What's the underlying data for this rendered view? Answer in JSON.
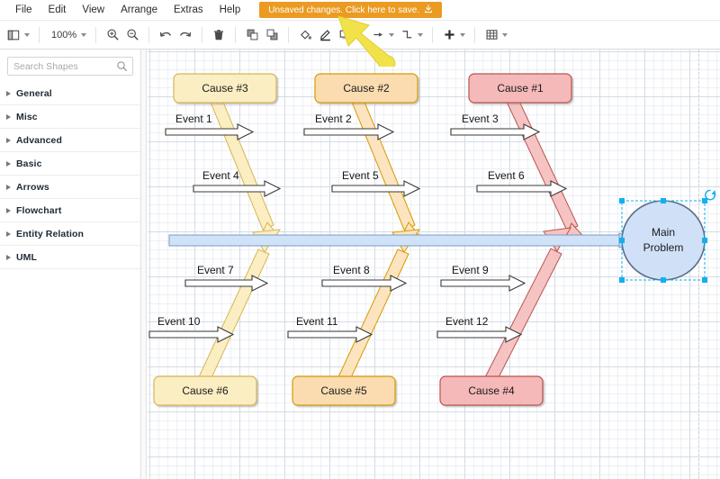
{
  "app": {
    "title": "draw.io diagram editor",
    "zoom": "100%"
  },
  "menu": {
    "items": [
      {
        "label": "File"
      },
      {
        "label": "Edit"
      },
      {
        "label": "View"
      },
      {
        "label": "Arrange"
      },
      {
        "label": "Extras"
      },
      {
        "label": "Help"
      }
    ],
    "unsaved": {
      "label": "Unsaved changes. Click here to save.",
      "icon": "save-icon",
      "background": "#eb9b21",
      "text_color": "#ffffff"
    }
  },
  "toolbar": {
    "view_icon": "layers-view-icon",
    "zoom_label": "100%",
    "zoom_in_icon": "zoom-in-icon",
    "zoom_out_icon": "zoom-out-icon",
    "undo_icon": "undo-icon",
    "redo_icon": "redo-icon",
    "delete_icon": "trash-icon",
    "to_front_icon": "bring-to-front-icon",
    "to_back_icon": "send-to-back-icon",
    "fill_icon": "fill-color-icon",
    "line_icon": "line-color-icon",
    "shadow_icon": "shadow-icon",
    "connection_icon": "connection-arrow-icon",
    "waypoints_icon": "waypoints-icon",
    "insert_icon": "insert-plus-icon",
    "table_icon": "table-grid-icon"
  },
  "sidebar": {
    "search": {
      "placeholder": "Search Shapes",
      "value": "",
      "icon": "search-icon"
    },
    "categories": [
      {
        "label": "General"
      },
      {
        "label": "Misc"
      },
      {
        "label": "Advanced"
      },
      {
        "label": "Basic"
      },
      {
        "label": "Arrows"
      },
      {
        "label": "Flowchart"
      },
      {
        "label": "Entity Relation"
      },
      {
        "label": "UML"
      }
    ]
  },
  "annotation": {
    "arrow_color": "#f2e24a",
    "arrow_name": "highlight-arrow-pointing-to-save-button"
  },
  "diagram": {
    "type": "fishbone-ishikawa",
    "spine": {
      "label": "",
      "fill": "#cfe2f7",
      "stroke": "#7a9bc4"
    },
    "effect": {
      "label_line1": "Main",
      "label_line2": "Problem",
      "fill": "#cfe0f7",
      "stroke": "#5b6f8c",
      "selected": true
    },
    "causes": [
      {
        "label": "Cause #3",
        "fill": "#fbeec3",
        "stroke": "#d6b656",
        "position": "top-left"
      },
      {
        "label": "Cause #2",
        "fill": "#fbdcb0",
        "stroke": "#d79b00",
        "position": "top-center"
      },
      {
        "label": "Cause #1",
        "fill": "#f6b9b9",
        "stroke": "#b85450",
        "position": "top-right"
      },
      {
        "label": "Cause #6",
        "fill": "#fbeec3",
        "stroke": "#d6b656",
        "position": "bottom-left"
      },
      {
        "label": "Cause #5",
        "fill": "#fbdcb0",
        "stroke": "#d79b00",
        "position": "bottom-center"
      },
      {
        "label": "Cause #4",
        "fill": "#f6b9b9",
        "stroke": "#b85450",
        "position": "bottom-right"
      }
    ],
    "events": [
      {
        "label": "Event 1"
      },
      {
        "label": "Event 2"
      },
      {
        "label": "Event 3"
      },
      {
        "label": "Event 4"
      },
      {
        "label": "Event 5"
      },
      {
        "label": "Event 6"
      },
      {
        "label": "Event 7"
      },
      {
        "label": "Event 8"
      },
      {
        "label": "Event 9"
      },
      {
        "label": "Event 10"
      },
      {
        "label": "Event 11"
      },
      {
        "label": "Event 12"
      }
    ],
    "selection": {
      "handle_color": "#12b0f0",
      "outline_color": "#12b0f0",
      "rotate_icon": "rotate-handle-icon"
    }
  }
}
